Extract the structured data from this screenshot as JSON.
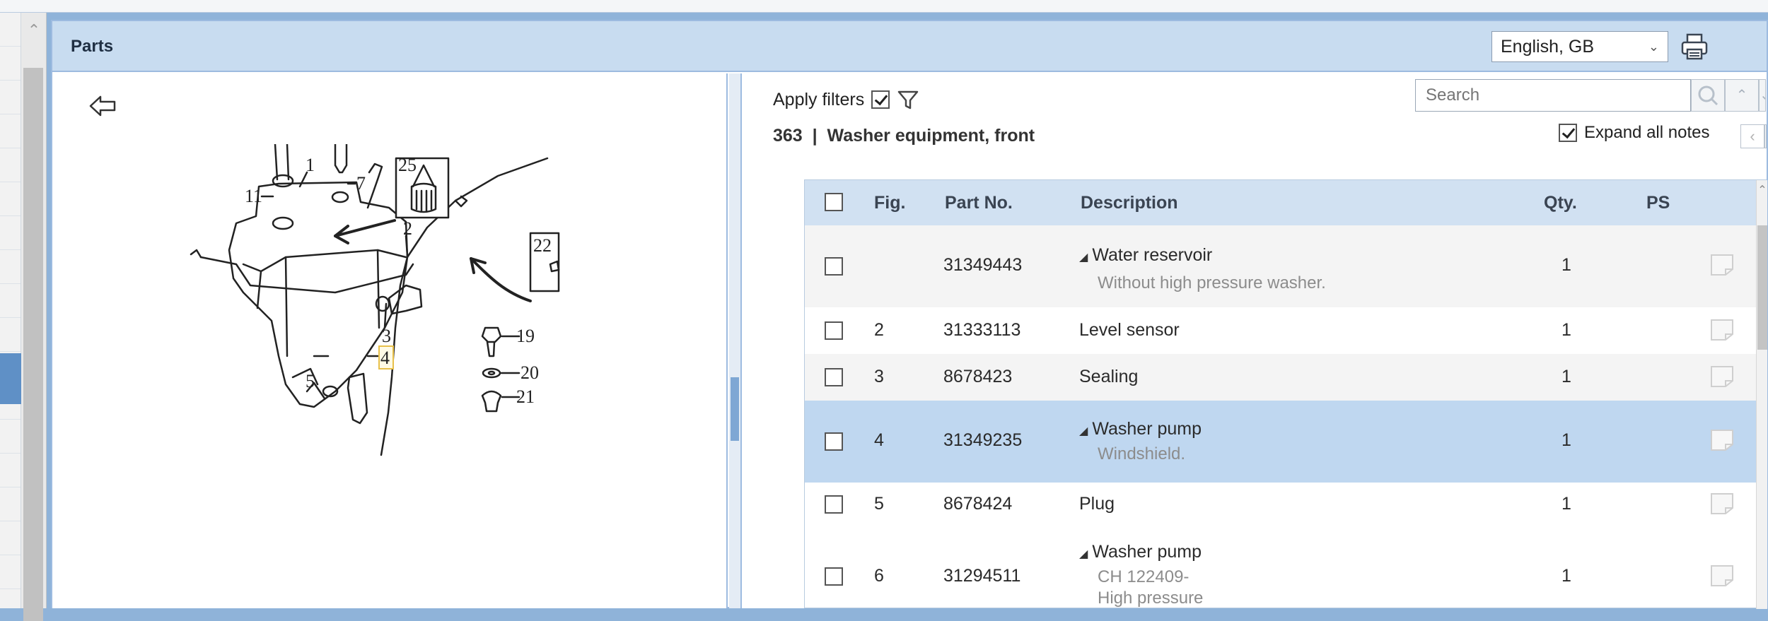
{
  "panel": {
    "title": "Parts",
    "language": "English, GB"
  },
  "filters": {
    "apply_label": "Apply filters",
    "apply_checked": true,
    "search_placeholder": "Search"
  },
  "group": {
    "number": "363",
    "separator": "|",
    "name": "Washer equipment, front"
  },
  "expand_notes": {
    "label": "Expand all notes",
    "checked": true
  },
  "table": {
    "headers": {
      "fig": "Fig.",
      "part_no": "Part No.",
      "description": "Description",
      "qty": "Qty.",
      "ps": "PS"
    },
    "rows": [
      {
        "fig": "",
        "part_no": "31349443",
        "description": "Water reservoir",
        "note": "Without high pressure washer.",
        "qty": "1",
        "expandable": true
      },
      {
        "fig": "2",
        "part_no": "31333113",
        "description": "Level sensor",
        "note": "",
        "qty": "1",
        "expandable": false
      },
      {
        "fig": "3",
        "part_no": "8678423",
        "description": "Sealing",
        "note": "",
        "qty": "1",
        "expandable": false
      },
      {
        "fig": "4",
        "part_no": "31349235",
        "description": "Washer pump",
        "note": "Windshield.",
        "qty": "1",
        "expandable": true,
        "selected": true
      },
      {
        "fig": "5",
        "part_no": "8678424",
        "description": "Plug",
        "note": "",
        "qty": "1",
        "expandable": false
      },
      {
        "fig": "6",
        "part_no": "31294511",
        "description": "Washer pump",
        "note": "CH 122409-",
        "note2": "High pressure",
        "qty": "1",
        "expandable": true
      }
    ]
  },
  "diagram": {
    "callouts": [
      "1",
      "2",
      "3",
      "4",
      "5",
      "7",
      "11",
      "19",
      "20",
      "21",
      "22",
      "25"
    ],
    "highlighted_callout": "4"
  },
  "icons": {
    "back": "back-arrow-icon",
    "print": "printer-icon",
    "filter": "funnel-icon",
    "search": "magnifier-icon",
    "ps": "document-icon"
  }
}
